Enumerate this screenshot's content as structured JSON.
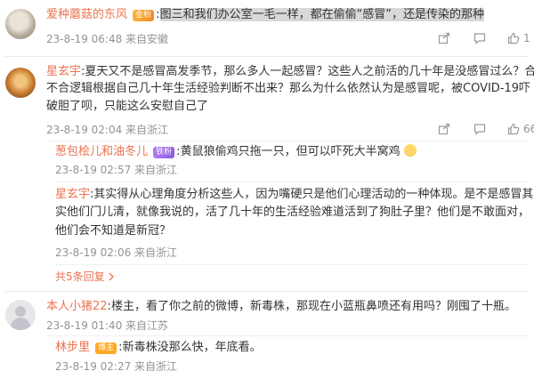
{
  "comments": [
    {
      "author": "爱种蘑菇的东风",
      "badge": "金粉",
      "text_hl": "图三和我们办公室一毛一样，都在偷偷“感冒”，还是传染的那种",
      "time": "23-8-19 06:48 来自安徽",
      "likes": "1"
    },
    {
      "author": "星玄宇",
      "line1": "夏天又不是感冒高发季节，那么多人一起感冒？这些人之前活的几十年是没感冒过么？合",
      "line2": "不合逻辑根据自己几十年生活经验判断不出来？那么为什么依然认为是感冒呢，被COVID-19吓",
      "line3": "破胆了呗，只能这么安慰自己了",
      "time": "23-8-19 02:04 来自浙江",
      "likes": "66",
      "replies": [
        {
          "author": "葱包桧儿和油冬儿",
          "badge": "铁粉",
          "text": "黄鼠狼偷鸡只拖一只，但可以吓死大半窝鸡",
          "time": "23-8-19 02:57 来自浙江"
        },
        {
          "author": "星玄宇",
          "line1": "其实得从心理角度分析这些人，因为嘴硬只是他们心理活动的一种体现。是不是感冒其",
          "line2": "实他们门儿清，就像我说的，活了几十年的生活经验难道活到了狗肚子里？他们是不敢面对，",
          "line3": "他们会不知道是新冠？",
          "time": "23-8-19 02:06 来自浙江"
        }
      ],
      "more_replies": "共5条回复"
    },
    {
      "author": "本人小猪22",
      "text": "楼主，看了你之前的微博，新毒株，那现在小蓝瓶鼻喷还有用吗？刚囤了十瓶。",
      "time": "23-8-19 01:40 来自江苏",
      "replies": [
        {
          "author": "林步里",
          "badge": "博主",
          "text": "新毒株没那么快，年底看。",
          "time": "23-8-19 02:27 来自浙江"
        }
      ]
    }
  ],
  "colon": ":",
  "icons": [
    "share-icon",
    "comment-icon",
    "like-icon"
  ],
  "accent_color": "#eb7350"
}
